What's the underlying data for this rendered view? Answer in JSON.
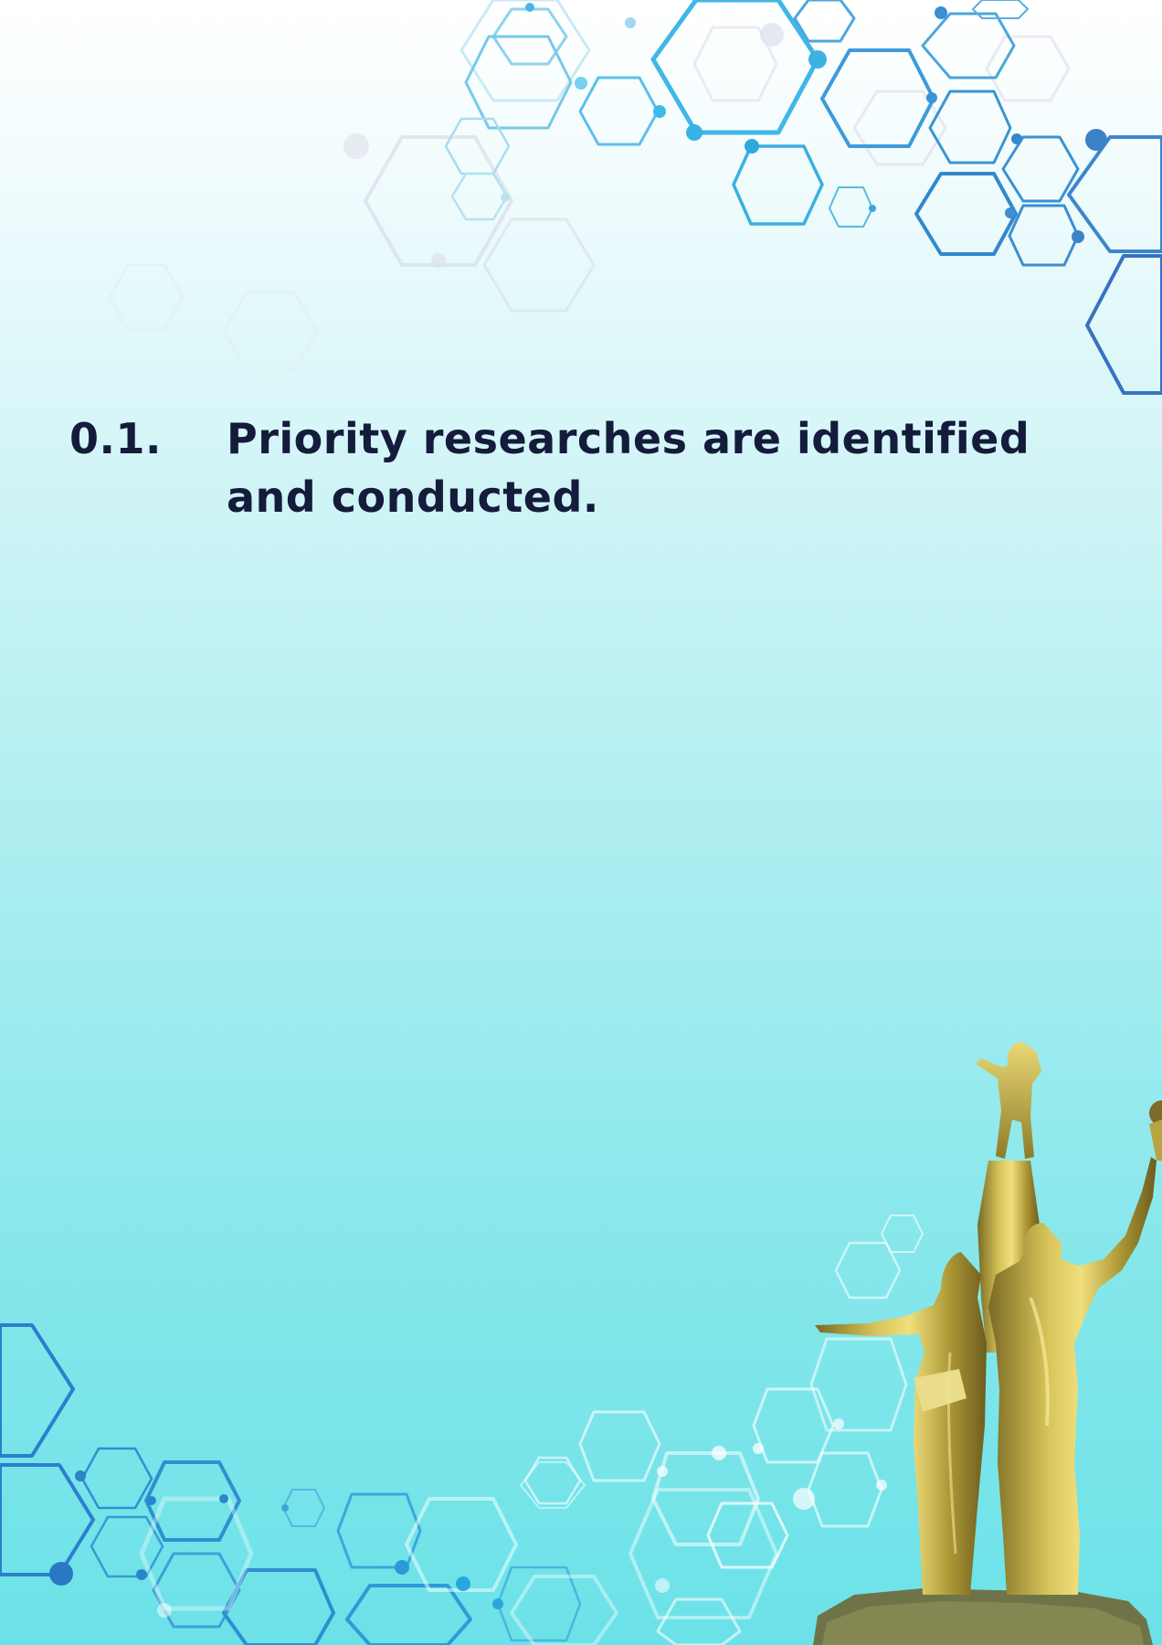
{
  "section": {
    "number": "0.1.",
    "title": "Priority researches are identified and conducted."
  },
  "colors": {
    "heading_text": "#141b3b",
    "hex_primary": "#3db6e6",
    "hex_secondary": "#2b7cc9",
    "statue_gold": "#c9b24a"
  },
  "decorations": {
    "top_right": "hexagon-network-pattern",
    "bottom": "hexagon-network-pattern",
    "bottom_right": "golden-monument-statue"
  }
}
